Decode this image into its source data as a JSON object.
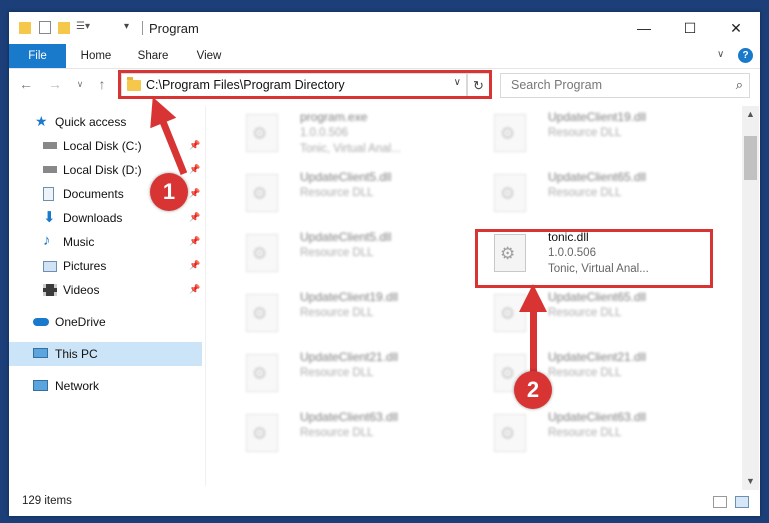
{
  "window": {
    "title": "Program"
  },
  "ribbon": {
    "tabs": [
      {
        "label": "File"
      },
      {
        "label": "Home"
      },
      {
        "label": "Share"
      },
      {
        "label": "View"
      }
    ]
  },
  "address": {
    "path": "C:\\Program Files\\Program Directory"
  },
  "search": {
    "placeholder": "Search Program"
  },
  "nav": {
    "items": [
      {
        "label": "Quick access",
        "icon": "star-icon"
      },
      {
        "label": "Local Disk (C:)",
        "icon": "drive-icon"
      },
      {
        "label": "Local Disk (D:)",
        "icon": "drive-icon"
      },
      {
        "label": "Documents",
        "icon": "documents-icon"
      },
      {
        "label": "Downloads",
        "icon": "download-icon"
      },
      {
        "label": "Music",
        "icon": "music-icon"
      },
      {
        "label": "Pictures",
        "icon": "pictures-icon"
      },
      {
        "label": "Videos",
        "icon": "videos-icon"
      },
      {
        "label": "OneDrive",
        "icon": "cloud-icon"
      },
      {
        "label": "This PC",
        "icon": "computer-icon"
      },
      {
        "label": "Network",
        "icon": "network-icon"
      }
    ]
  },
  "files": [
    {
      "name": "program.exe",
      "version": "1.0.0.506",
      "desc": "Tonic, Virtual Anal..."
    },
    {
      "name": "UpdateClient19.dll",
      "desc": "Resource DLL"
    },
    {
      "name": "UpdateClient5.dll",
      "desc": "Resource DLL"
    },
    {
      "name": "UpdateClient65.dll",
      "desc": "Resource DLL"
    },
    {
      "name": "UpdateClient5.dll",
      "desc": "Resource DLL"
    },
    {
      "name": "tonic.dll",
      "version": "1.0.0.506",
      "desc": "Tonic, Virtual Anal..."
    },
    {
      "name": "UpdateClient19.dll",
      "desc": "Resource DLL"
    },
    {
      "name": "UpdateClient65.dll",
      "desc": "Resource DLL"
    },
    {
      "name": "UpdateClient21.dll",
      "desc": "Resource DLL"
    },
    {
      "name": "UpdateClient21.dll",
      "desc": "Resource DLL"
    },
    {
      "name": "UpdateClient63.dll",
      "desc": "Resource DLL"
    },
    {
      "name": "UpdateClient63.dll",
      "desc": "Resource DLL"
    }
  ],
  "status": {
    "count": "129 items"
  },
  "markers": {
    "m1": "1",
    "m2": "2"
  },
  "colors": {
    "accent": "#1979ca",
    "highlight": "#d83434",
    "selected": "#cce4f7"
  }
}
